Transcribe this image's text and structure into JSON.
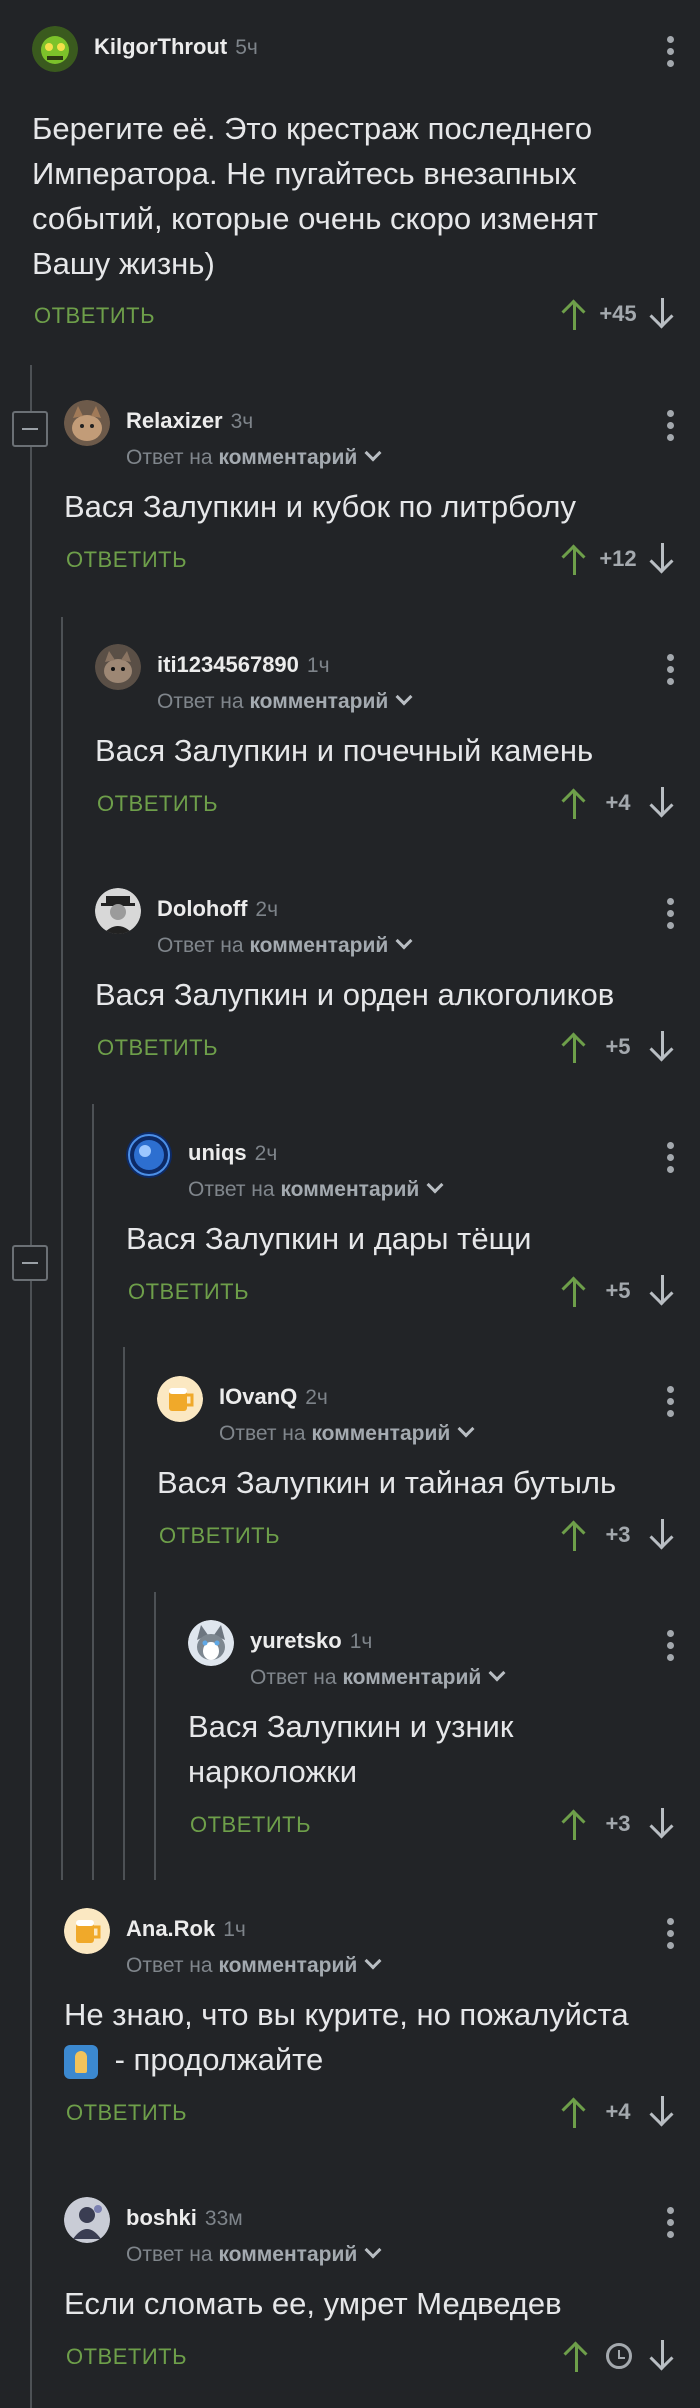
{
  "reply_label": "ОТВЕТИТЬ",
  "reply_to": {
    "prefix": "Ответ на",
    "target": "комментарий"
  },
  "comments": [
    {
      "author": "KilgorThrout",
      "time": "5ч",
      "text": "Берегите её. Это крестраж последнего\nИмператора. Не пугайтесь внезапных\nсобытий, которые очень скоро изменят\nВашу жизнь)",
      "score": "+45",
      "avatar": "green-creature"
    },
    {
      "author": "Relaxizer",
      "time": "3ч",
      "text": "Вася Залупкин и кубок по литрболу",
      "score": "+12",
      "avatar": "cat"
    },
    {
      "author": "iti1234567890",
      "time": "1ч",
      "text": "Вася Залупкин и почечный камень",
      "score": "+4",
      "avatar": "cat2"
    },
    {
      "author": "Dolohoff",
      "time": "2ч",
      "text": "Вася Залупкин и орден алкоголиков",
      "score": "+5",
      "avatar": "man-hat"
    },
    {
      "author": "uniqs",
      "time": "2ч",
      "text": "Вася Залупкин и дары тёщи",
      "score": "+5",
      "avatar": "blue-orb"
    },
    {
      "author": "IOvanQ",
      "time": "2ч",
      "text": "Вася Залупкин и тайная бутыль",
      "score": "+3",
      "avatar": "beer"
    },
    {
      "author": "yuretsko",
      "time": "1ч",
      "text": "Вася Залупкин и узник\nнарколожки",
      "score": "+3",
      "avatar": "husky"
    },
    {
      "author": "Ana.Rok",
      "time": "1ч",
      "text_line1": "Не знаю, что вы курите, но пожалуйста",
      "text_line2": " - продолжайте",
      "score": "+4",
      "avatar": "beer"
    },
    {
      "author": "boshki",
      "time": "33м",
      "text": "Если сломать ее, умрет Медведев",
      "score": "",
      "avatar": "person"
    }
  ],
  "colors": {
    "background": "#222427",
    "accent_green": "#6e9f4a",
    "muted": "#80868c"
  }
}
